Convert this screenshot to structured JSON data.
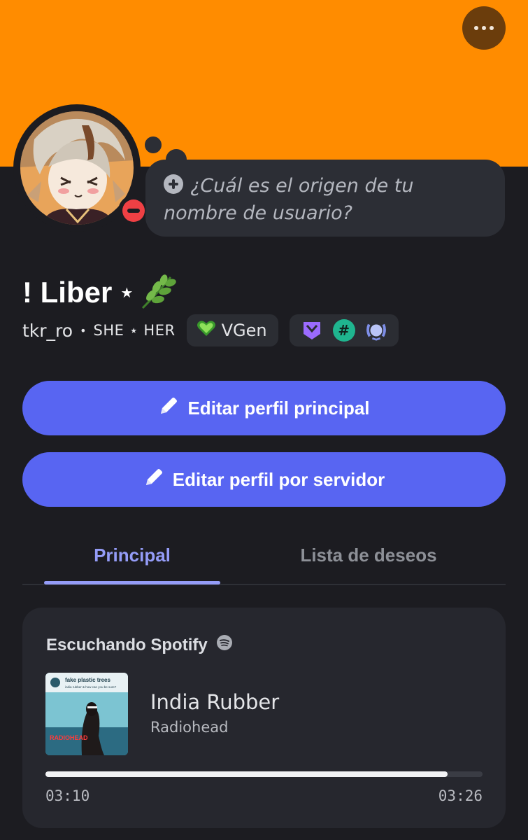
{
  "profile": {
    "display_name": "! Liber",
    "name_star": "★",
    "username": "tkr_ro",
    "separator": "•",
    "pronouns": "SHE ⋆ HER",
    "status": "dnd",
    "custom_status_prompt": "¿Cuál es el origen de tu nombre de usuario?"
  },
  "connections": {
    "vgen_label": "VGen"
  },
  "badges": [
    "twitch-icon",
    "hashtag-badge-icon",
    "laurel-badge-icon"
  ],
  "buttons": {
    "edit_main": "Editar perfil principal",
    "edit_server": "Editar perfil por servidor"
  },
  "tabs": [
    {
      "label": "Principal",
      "active": true
    },
    {
      "label": "Lista de deseos",
      "active": false
    }
  ],
  "activity": {
    "header": "Escuchando Spotify",
    "track_title": "India Rubber",
    "artist": "Radiohead",
    "cover_text_top": "fake plastic trees",
    "cover_text_sub": "india rubber & how can you be sure?",
    "cover_band": "RADIOHEAD",
    "elapsed": "03:10",
    "duration": "03:26",
    "progress": 0.92
  },
  "colors": {
    "banner": "#ff8c00",
    "accent": "#5865f2",
    "tab_active": "#949cf7",
    "background": "#1c1c21",
    "card": "#26272e",
    "dnd_status": "#ef4044"
  }
}
